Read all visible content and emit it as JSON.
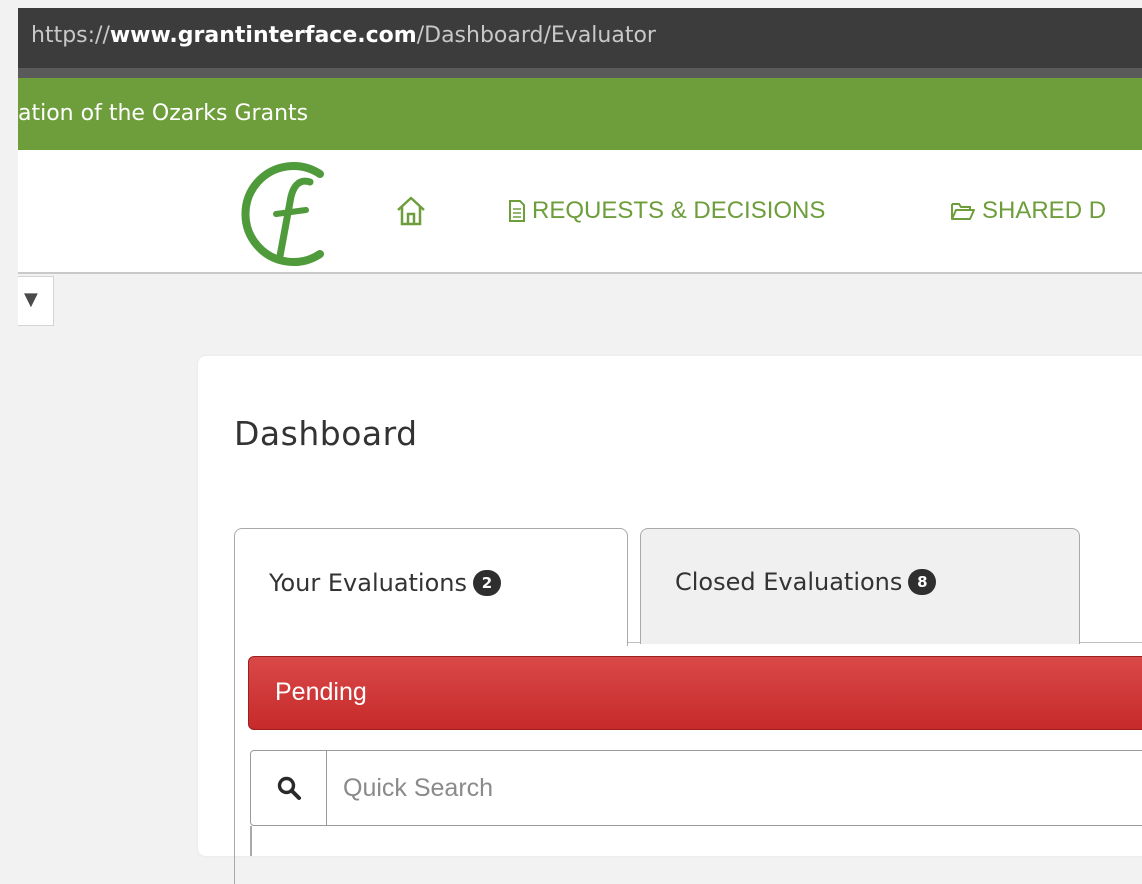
{
  "browser": {
    "url_scheme": "https://",
    "url_host": "www.grantinterface.com",
    "url_path": "/Dashboard/Evaluator"
  },
  "site": {
    "title": "ation of the Ozarks Grants",
    "brand_color": "#6e9e3c"
  },
  "nav": {
    "home_icon": "home-icon",
    "items": [
      {
        "label": "REQUESTS & DECISIONS",
        "icon": "document-icon"
      },
      {
        "label": "SHARED D",
        "icon": "folder-open-icon"
      }
    ]
  },
  "sidebar_toggle": {
    "glyph": "▼"
  },
  "page": {
    "title": "Dashboard"
  },
  "tabs": [
    {
      "label": "Your Evaluations",
      "count": "2",
      "active": true
    },
    {
      "label": "Closed Evaluations",
      "count": "8",
      "active": false
    }
  ],
  "panel": {
    "status_header": "Pending",
    "status_color": "#c72a2a",
    "search": {
      "placeholder": "Quick Search",
      "value": ""
    }
  }
}
